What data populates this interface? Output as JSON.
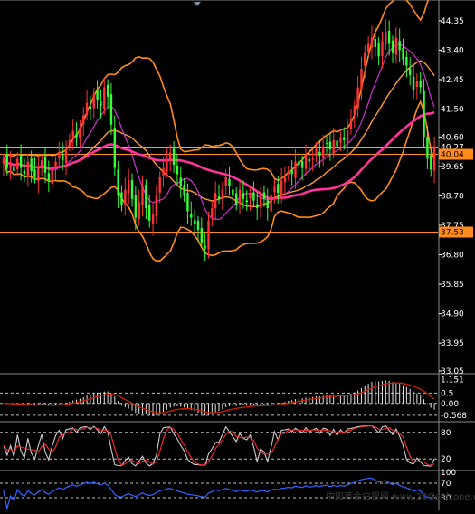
{
  "colors": {
    "background": "#000000",
    "axis_text": "#ffffff",
    "candle_up": "#ff3333",
    "candle_down": "#33ff33",
    "ma_slow": "#ff3399",
    "ma_mid": "#ff9933",
    "ma_fast": "#cc33cc",
    "bollinger": "#ff8c1a",
    "hline_white": "#c8c8c8",
    "hline_orange": "#ff8c1a",
    "price_tag_bg": "#ff8c1a",
    "macd_hist": "#e6e6e6",
    "macd_signal": "#cc2200",
    "stoch_main": "#cfcfcf",
    "stoch_signal": "#ff2a2a",
    "rsi_line": "#3366ff",
    "dashed_level": "#bdbdbd",
    "panel_border": "#8a8a8a"
  },
  "chart_data": [
    {
      "type": "candlestick",
      "panel": "price",
      "ylim": [
        33.05,
        44.9
      ],
      "y_ticks": [
        "44.35",
        "43.40",
        "42.45",
        "41.50",
        "40.60",
        "39.65",
        "38.70",
        "37.75",
        "36.80",
        "35.85",
        "34.90",
        "33.95",
        "33.05"
      ],
      "price_labels": [
        {
          "text": "40.27",
          "value": 40.27,
          "kind": "white"
        },
        {
          "text": "40.04",
          "value": 40.04,
          "kind": "orange"
        },
        {
          "text": "37.53",
          "value": 37.53,
          "kind": "orange"
        }
      ],
      "closes": [
        39.9,
        39.6,
        39.75,
        39.5,
        39.9,
        39.6,
        39.4,
        39.8,
        39.5,
        39.3,
        39.6,
        39.85,
        39.45,
        39.2,
        39.55,
        39.8,
        40.1,
        39.85,
        40.2,
        40.5,
        40.8,
        40.6,
        40.9,
        41.3,
        41.7,
        41.5,
        42.0,
        41.8,
        41.6,
        42.2,
        41.9,
        41.0,
        39.6,
        38.7,
        38.4,
        38.9,
        39.2,
        38.6,
        38.0,
        38.5,
        39.0,
        38.3,
        37.9,
        38.1,
        38.7,
        39.3,
        39.6,
        39.9,
        40.1,
        39.7,
        39.4,
        39.0,
        38.7,
        38.2,
        38.0,
        37.8,
        37.6,
        37.2,
        37.0,
        37.9,
        38.3,
        38.8,
        38.6,
        38.9,
        39.3,
        39.0,
        38.7,
        38.4,
        38.9,
        38.6,
        38.5,
        38.8,
        38.55,
        38.3,
        38.7,
        38.6,
        38.3,
        38.75,
        39.0,
        38.8,
        39.2,
        39.3,
        39.5,
        39.4,
        39.8,
        39.7,
        39.6,
        40.0,
        39.8,
        39.9,
        40.2,
        40.0,
        40.3,
        40.4,
        40.2,
        40.5,
        40.3,
        40.6,
        40.5,
        40.8,
        41.2,
        41.6,
        42.2,
        42.8,
        43.3,
        43.6,
        43.8,
        43.5,
        43.2,
        43.7,
        44.0,
        43.6,
        43.3,
        43.8,
        43.4,
        43.1,
        42.9,
        42.6,
        42.1,
        42.4,
        42.2,
        40.6,
        39.9,
        39.55,
        40.3
      ]
    },
    {
      "type": "histogram",
      "panel": "macd",
      "y_ticks": [
        "1.151",
        "0.5",
        "0.00",
        "-0.568"
      ],
      "ylim": [
        -0.75,
        1.3
      ],
      "levels": [
        0.5,
        0.0,
        -0.568
      ]
    },
    {
      "type": "line",
      "panel": "stochastic",
      "y_ticks": [
        "80",
        "20"
      ],
      "ylim": [
        0,
        100
      ],
      "levels": [
        80,
        20
      ]
    },
    {
      "type": "line",
      "panel": "rsi",
      "y_ticks": [
        "100",
        "70",
        "30"
      ],
      "ylim": [
        0,
        100
      ],
      "levels": [
        70,
        30
      ]
    }
  ],
  "watermark": "中国黄金白银网 www.24Goldzone.com"
}
